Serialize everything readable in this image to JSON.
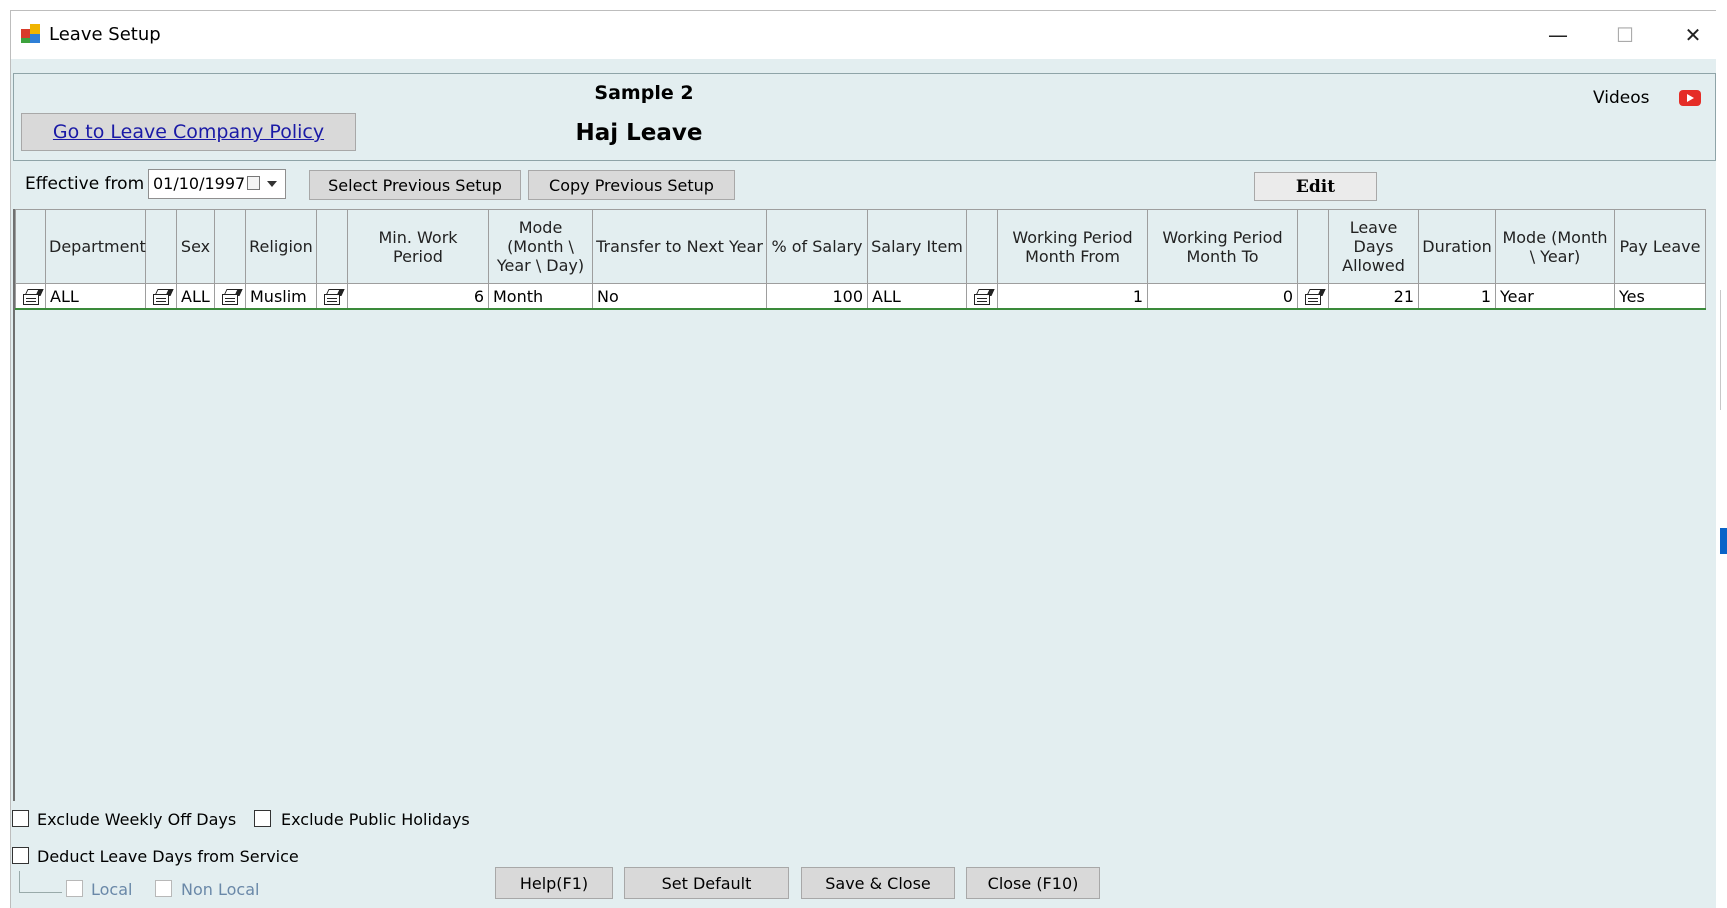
{
  "window": {
    "title": "Leave Setup",
    "controls": {
      "minimize": "—",
      "maximize": "☐",
      "close": "✕"
    }
  },
  "header": {
    "sample_title": "Sample 2",
    "leave_title": "Haj Leave",
    "policy_link": "Go to Leave Company Policy",
    "videos_label": "Videos"
  },
  "toolbar": {
    "effective_label": "Effective from :",
    "effective_date": "01/10/1997",
    "select_previous": "Select Previous Setup",
    "copy_previous": "Copy Previous Setup",
    "edit": "Edit"
  },
  "grid": {
    "headers": {
      "department": "Department",
      "sex": "Sex",
      "religion": "Religion",
      "min_work_period": "Min. Work Period",
      "mode": "Mode (Month \\ Year \\ Day)",
      "transfer": "Transfer to Next Year",
      "pct_salary": "% of Salary",
      "salary_item": "Salary Item",
      "wp_from": "Working Period Month From",
      "wp_to": "Working Period Month To",
      "leave_days": "Leave Days Allowed",
      "duration": "Duration",
      "mode_month_year": "Mode (Month \\ Year)",
      "pay_leave": "Pay Leave"
    },
    "rows": [
      {
        "department": "ALL",
        "sex": "ALL",
        "religion": "Muslim",
        "min_work_period": "6",
        "mode": "Month",
        "transfer": "No",
        "pct_salary": "100",
        "salary_item": "ALL",
        "wp_from": "1",
        "wp_to": "0",
        "leave_days": "21",
        "duration": "1",
        "mode_month_year": "Year",
        "pay_leave": "Yes"
      }
    ]
  },
  "options": {
    "exclude_weekly": "Exclude Weekly Off Days",
    "exclude_holidays": "Exclude Public Holidays",
    "deduct_leave": "Deduct Leave Days from Service",
    "local": "Local",
    "non_local": "Non Local"
  },
  "footer": {
    "help": "Help(F1)",
    "set_default": "Set Default",
    "save_close": "Save & Close",
    "close": "Close (F10)"
  }
}
